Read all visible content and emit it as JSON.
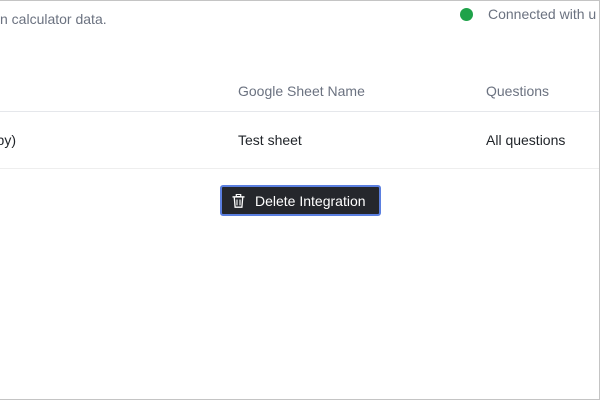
{
  "header": {
    "description_fragment": "n calculator data.",
    "status_text": "Connected with u",
    "status_color": "#1fa24a"
  },
  "table": {
    "columns": [
      "",
      "Google Sheet Name",
      "Questions"
    ],
    "rows": [
      [
        "py)",
        "Test sheet",
        "All questions"
      ]
    ]
  },
  "actions": {
    "delete_label": "Delete Integration",
    "delete_icon": "trash-icon",
    "button_bg": "#25272c",
    "focus_ring": "#5b7fe0"
  }
}
